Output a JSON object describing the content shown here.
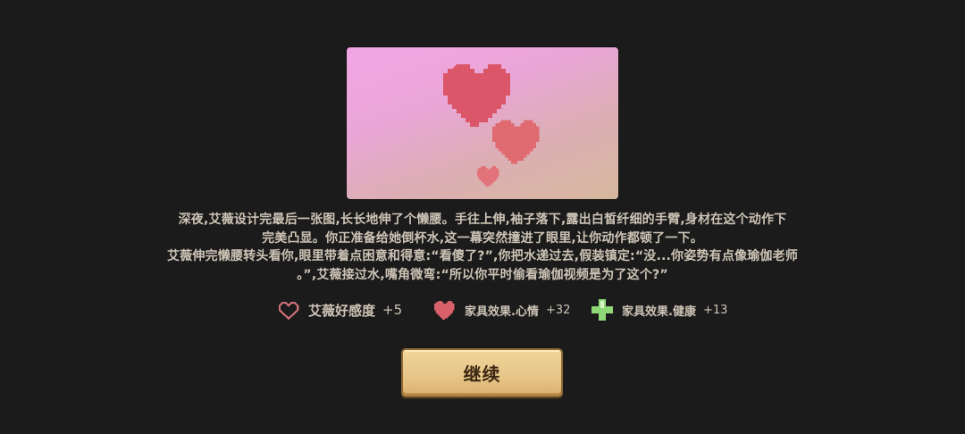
{
  "event": {
    "image_icons": [
      "heart-icon",
      "heart-icon",
      "heart-icon"
    ],
    "story_lines": [
      "深夜,艾薇设计完最后一张图,长长地伸了个懒腰。手往上伸,袖子落下,露出白皙纤细的手臂,身材在这个动作下",
      "完美凸显。你正准备给她倒杯水,这一幕突然撞进了眼里,让你动作都顿了一下。",
      "艾薇伸完懒腰转头看你,眼里带着点困意和得意:“看傻了?”,你把水递过去,假装镇定:“没...你姿势有点像瑜伽老师",
      "。”,艾薇接过水,嘴角微弯:“所以你平时偷看瑜伽视频是为了这个?”"
    ]
  },
  "stats": {
    "affection": {
      "icon": "heart-outline-icon",
      "label": "艾薇好感度",
      "value": "+5",
      "color": "#d0707a"
    },
    "mood": {
      "icon": "heart-icon",
      "label": "家具效果.心情",
      "value": "+32",
      "color": "#d8606a"
    },
    "health": {
      "icon": "plus-cross-icon",
      "label": "家具效果.健康",
      "value": "+13",
      "color": "#8fd878"
    }
  },
  "actions": {
    "continue_label": "继续"
  },
  "colors": {
    "background": "#1b1b1b",
    "text": "#cdc4b6",
    "button": "#e7c588",
    "heart": "#d95566"
  }
}
